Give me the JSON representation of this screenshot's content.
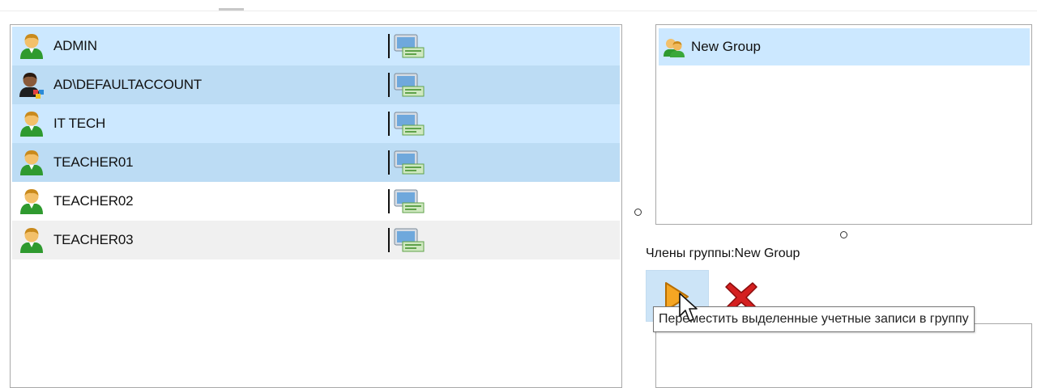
{
  "accounts": [
    {
      "name": "ADMIN",
      "icon": "user-icon",
      "state": "selected"
    },
    {
      "name": "AD\\DEFAULTACCOUNT",
      "icon": "user-shared-icon",
      "state": "selected"
    },
    {
      "name": "IT TECH",
      "icon": "user-icon",
      "state": "selected"
    },
    {
      "name": "TEACHER01",
      "icon": "user-icon",
      "state": "selected"
    },
    {
      "name": "TEACHER02",
      "icon": "user-icon",
      "state": "normal"
    },
    {
      "name": "TEACHER03",
      "icon": "user-icon",
      "state": "hover"
    }
  ],
  "groups": [
    {
      "name": "New Group",
      "icon": "group-icon",
      "state": "selected"
    }
  ],
  "members": {
    "label": "Члены группы:New Group"
  },
  "tooltip": {
    "text": "Переместить выделенные учетные записи в группу"
  },
  "colors": {
    "selection": "#cce8ff",
    "selection_alt": "#bcdcf4",
    "hover_row": "#f0f0f0",
    "border": "#a8a8a8",
    "move_arrow": "#f5a623",
    "delete_x": "#d42020"
  }
}
